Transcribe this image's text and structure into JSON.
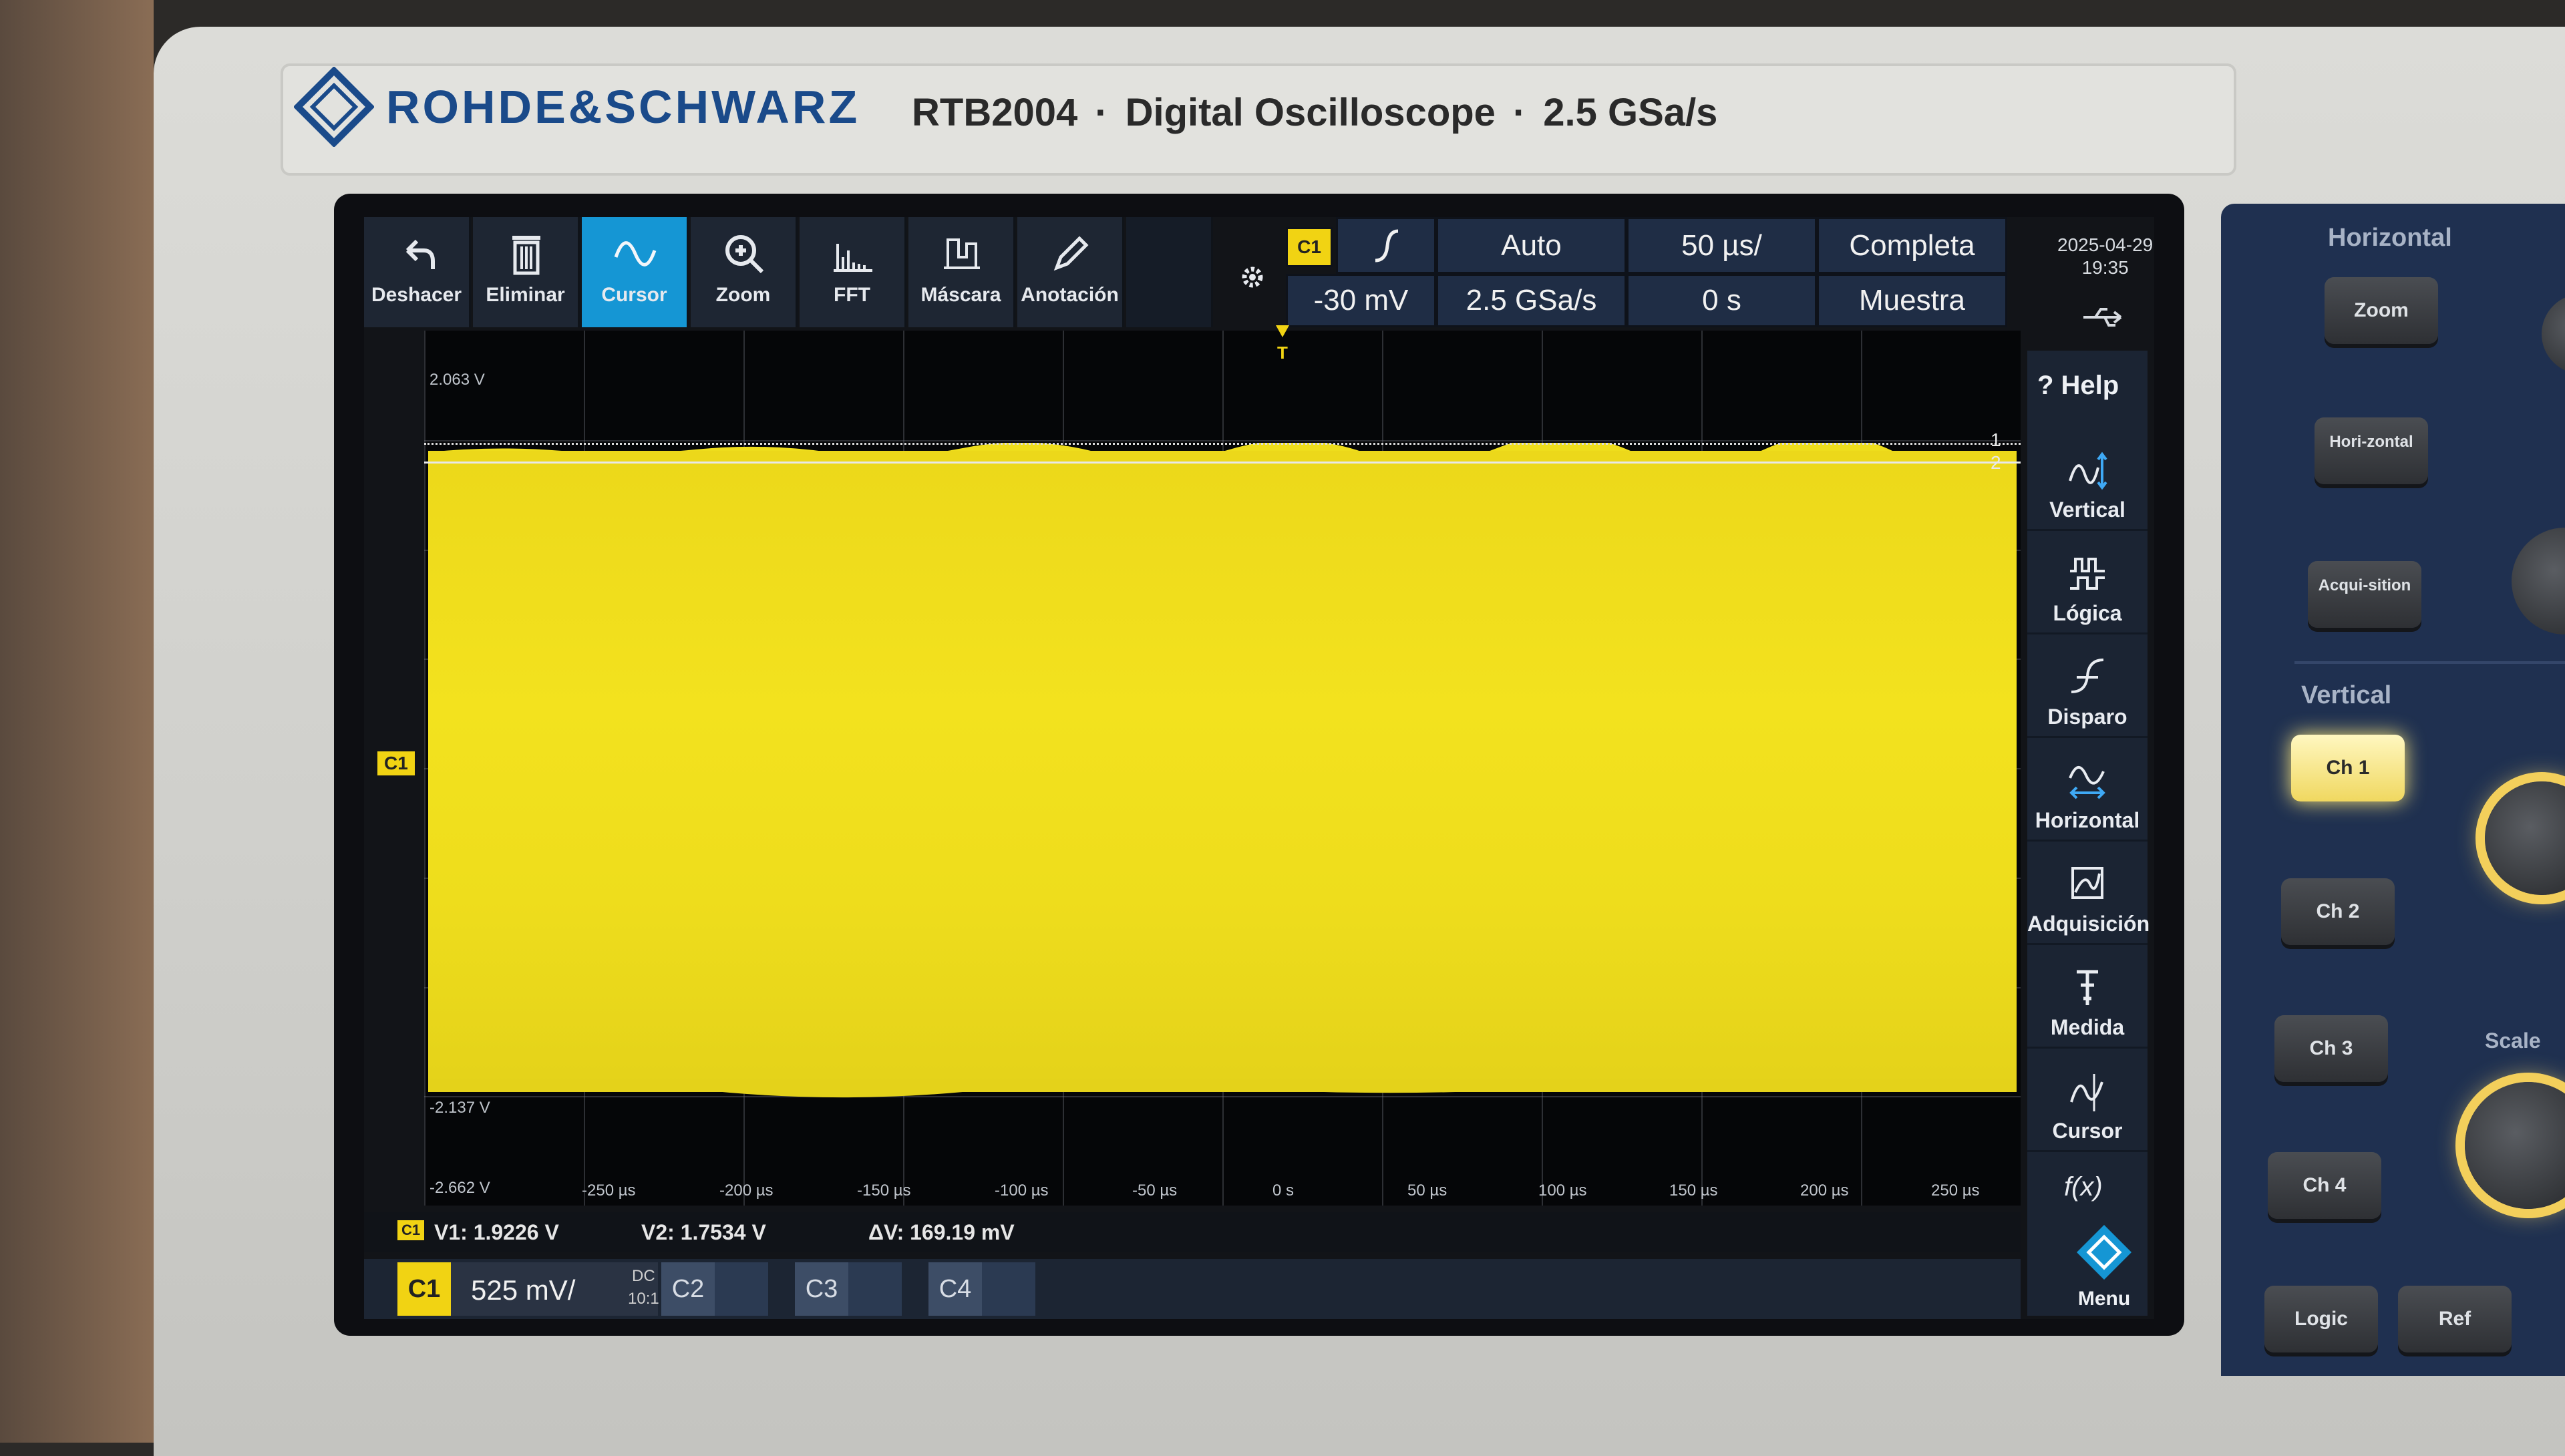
{
  "header": {
    "brand": "ROHDE&SCHWARZ",
    "model": "RTB2004",
    "model_desc": "Digital Oscilloscope",
    "sample_spec": "2.5 GSa/s",
    "separator": "·"
  },
  "toolbar": {
    "undo": "Deshacer",
    "delete": "Eliminar",
    "cursor": "Cursor",
    "zoom": "Zoom",
    "fft": "FFT",
    "mask": "Máscara",
    "annotation": "Anotación"
  },
  "params": {
    "trigger_source": "C1",
    "trigger_level": "-30 mV",
    "trigger_mode": "Auto",
    "sample_rate": "2.5 GSa/s",
    "timebase": "50 µs/",
    "position": "0 s",
    "record": "Completa",
    "acq_mode": "Muestra"
  },
  "datetime": {
    "date": "2025-04-29",
    "time": "19:35"
  },
  "plot": {
    "y_top": "2.063 V",
    "y_lower": "-2.137 V",
    "y_bottom": "-2.662 V",
    "cursor1_tag": "1",
    "cursor2_tag": "2",
    "trigger_tag": "T",
    "channel_tag": "C1",
    "x_ticks": [
      "-250 µs",
      "-200 µs",
      "-150 µs",
      "-100 µs",
      "-50 µs",
      "0 s",
      "50 µs",
      "100 µs",
      "150 µs",
      "200 µs",
      "250 µs"
    ]
  },
  "sidebar": {
    "help": "? Help",
    "vertical": "Vertical",
    "logic": "Lógica",
    "trigger": "Disparo",
    "horizontal": "Horizontal",
    "acquisition": "Adquisición",
    "measure": "Medida",
    "cursor": "Cursor",
    "math": "f(x)",
    "menu": "Menu"
  },
  "readout": {
    "source": "C1",
    "v1": "V1: 1.9226 V",
    "v2": "V2: 1.7534 V",
    "dv": "ΔV: 169.19 mV"
  },
  "channels": {
    "c1_label": "C1",
    "c1_scale": "525 mV/",
    "c1_coupling": "DC",
    "c1_probe": "10:1",
    "c2_label": "C2",
    "c3_label": "C3",
    "c4_label": "C4"
  },
  "hw_panel": {
    "horizontal_title": "Horizontal",
    "zoom_key": "Zoom",
    "horizontal_key": "Hori-zontal",
    "acquisition_key": "Acqui-sition",
    "vertical_title": "Vertical",
    "ch1": "Ch 1",
    "ch2": "Ch 2",
    "ch3": "Ch 3",
    "ch4": "Ch 4",
    "scale": "Scale",
    "logic_key": "Logic",
    "ref_key": "Ref"
  },
  "colors": {
    "ch1": "#f1d313",
    "active_tool": "#1596d4",
    "brand_blue": "#1a4a8a"
  }
}
